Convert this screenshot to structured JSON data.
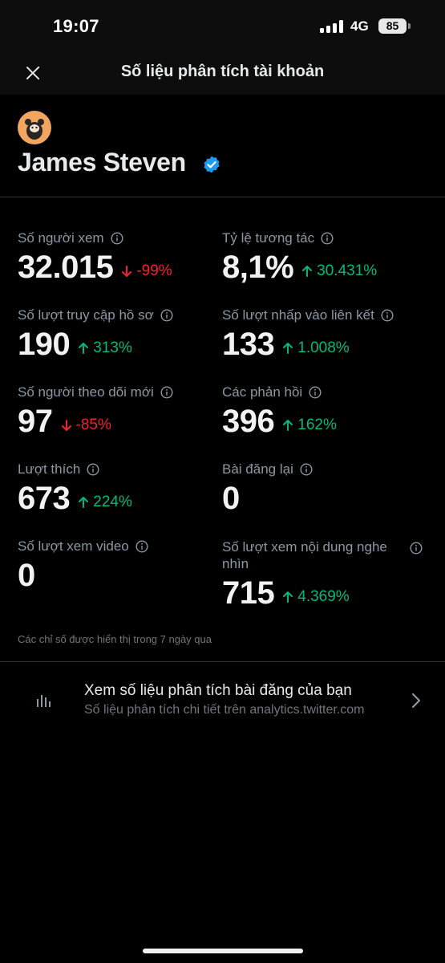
{
  "status": {
    "time": "19:07",
    "network": "4G",
    "battery": "85"
  },
  "header": {
    "title": "Số liệu phân tích tài khoản"
  },
  "profile": {
    "name": "James Steven"
  },
  "metrics": [
    {
      "label": "Số người xem",
      "value": "32.015",
      "change": "-99%",
      "direction": "down"
    },
    {
      "label": "Tỷ lệ tương tác",
      "value": "8,1%",
      "change": "30.431%",
      "direction": "up"
    },
    {
      "label": "Số lượt truy cập hồ sơ",
      "value": "190",
      "change": "313%",
      "direction": "up"
    },
    {
      "label": "Số lượt nhấp vào liên kết",
      "value": "133",
      "change": "1.008%",
      "direction": "up"
    },
    {
      "label": "Số người theo dõi mới",
      "value": "97",
      "change": "-85%",
      "direction": "down"
    },
    {
      "label": "Các phản hồi",
      "value": "396",
      "change": "162%",
      "direction": "up"
    },
    {
      "label": "Lượt thích",
      "value": "673",
      "change": "224%",
      "direction": "up"
    },
    {
      "label": "Bài đăng lại",
      "value": "0",
      "change": "",
      "direction": "none"
    },
    {
      "label": "Số lượt xem video",
      "value": "0",
      "change": "",
      "direction": "none"
    },
    {
      "label": "Số lượt xem nội dung nghe nhìn",
      "value": "715",
      "change": "4.369%",
      "direction": "up"
    }
  ],
  "footnote": "Các chỉ số được hiển thị trong 7 ngày qua",
  "analytics_link": {
    "title": "Xem số liệu phân tích bài đăng của bạn",
    "subtitle": "Số liệu phân tích chi tiết trên analytics.twitter.com"
  },
  "icons": {
    "close": "close-icon",
    "info": "info-icon",
    "verified": "verified-badge-icon",
    "chart": "bar-chart-icon",
    "chevron": "chevron-right-icon"
  },
  "colors": {
    "background": "#000000",
    "text_primary": "#e7e9ea",
    "text_secondary": "#8b98a5",
    "positive": "#00ba7c",
    "negative": "#f4212e",
    "verified": "#1d9bf0",
    "avatar": "#f2a55f"
  }
}
